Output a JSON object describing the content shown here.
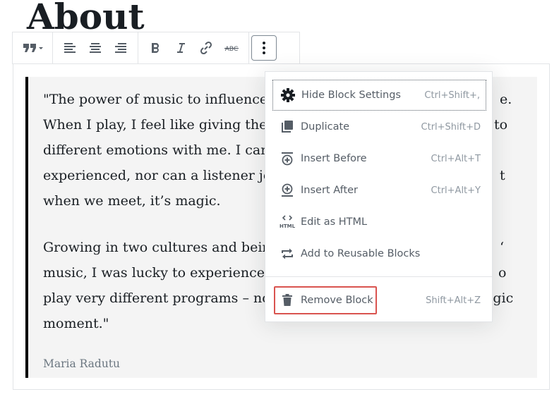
{
  "page": {
    "title": "About"
  },
  "toolbar": {
    "buttons": [
      {
        "name": "change-block-type-button",
        "icon": "quote-icon"
      },
      {
        "name": "align-left-button",
        "icon": "align-left-icon"
      },
      {
        "name": "align-center-button",
        "icon": "align-center-icon"
      },
      {
        "name": "align-right-button",
        "icon": "align-right-icon"
      },
      {
        "name": "bold-button",
        "icon": "bold-icon"
      },
      {
        "name": "italic-button",
        "icon": "italic-icon"
      },
      {
        "name": "link-button",
        "icon": "link-icon"
      },
      {
        "name": "strikethrough-button",
        "icon": "strikethrough-icon",
        "glyph": "ABC"
      },
      {
        "name": "more-options-button",
        "icon": "more-vertical-icon"
      }
    ]
  },
  "quote": {
    "lines_p1": [
      "\"The power of music to influence",
      "When I play, I feel like giving the",
      "different emotions with me. I can",
      "experienced, nor can a listener jo",
      "when we meet, it’s magic."
    ],
    "lines_p1_tail": [
      "e.",
      "to",
      "",
      "t",
      ""
    ],
    "lines_p2": [
      "Growing in two cultures and bein",
      "music, I was lucky to experience",
      "play very different programs – no",
      "moment.\""
    ],
    "lines_p2_tail": [
      "‘",
      "o",
      "agic",
      ""
    ],
    "citation": "Maria Radutu"
  },
  "menu": {
    "items": [
      {
        "label": "Hide Block Settings",
        "shortcut": "Ctrl+Shift+,",
        "icon": "gear-icon"
      },
      {
        "label": "Duplicate",
        "shortcut": "Ctrl+Shift+D",
        "icon": "duplicate-icon"
      },
      {
        "label": "Insert Before",
        "shortcut": "Ctrl+Alt+T",
        "icon": "insert-before-icon"
      },
      {
        "label": "Insert After",
        "shortcut": "Ctrl+Alt+Y",
        "icon": "insert-after-icon"
      },
      {
        "label": "Edit as HTML",
        "shortcut": "",
        "icon": "html-icon",
        "icon_text": "HTML"
      },
      {
        "label": "Add to Reusable Blocks",
        "shortcut": "",
        "icon": "reusable-block-icon"
      },
      {
        "label": "Remove Block",
        "shortcut": "Shift+Alt+Z",
        "icon": "trash-icon"
      }
    ]
  },
  "colors": {
    "highlight": "#d9534f",
    "quote_bg": "#f4f4f4",
    "text": "#191e23",
    "muted": "#555d66"
  }
}
